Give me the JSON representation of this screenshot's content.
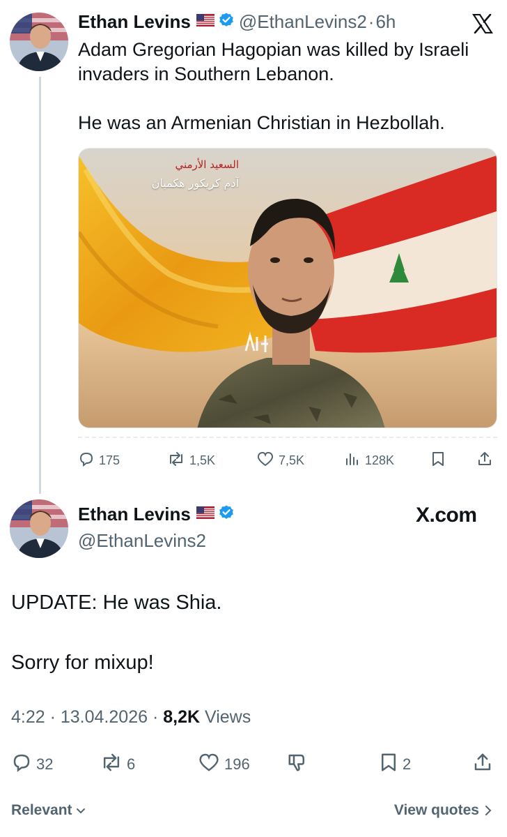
{
  "tweet": {
    "author_name": "Ethan Levins",
    "flag_icon": "us-flag-icon",
    "handle": "@EthanLevins2",
    "dot": "·",
    "time": "6h",
    "text_line1": "Adam Gregorian Hagopian was killed by Israeli invaders in Southern Lebanon.",
    "text_line2": "He was an Armenian Christian in Hezbollah.",
    "image": {
      "arabic_line1": "السعيد الأرمني",
      "arabic_line2": "آدم كريكور هكميان",
      "watermark": "أهل الحق"
    },
    "actions": {
      "replies": "175",
      "reposts": "1,5K",
      "likes": "7,5K",
      "views": "128K"
    }
  },
  "quote_header": {
    "author_name": "Ethan Levins",
    "handle": "@EthanLevins2",
    "site": "X.com"
  },
  "reply": {
    "line1": "UPDATE: He was Shia.",
    "line2": "Sorry for mixup!",
    "timestamp": "4:22 · 13.04.2026 · ",
    "views_count": "8,2K",
    "views_label": " Views",
    "actions": {
      "replies": "32",
      "reposts": "6",
      "likes": "196",
      "bookmarks": "2"
    }
  },
  "footer": {
    "sort_label": "Relevant",
    "view_quotes": "View quotes"
  },
  "colors": {
    "text": "#0f1419",
    "secondary": "#536471",
    "verified": "#1d9bf0",
    "divider": "#cfd9de"
  }
}
